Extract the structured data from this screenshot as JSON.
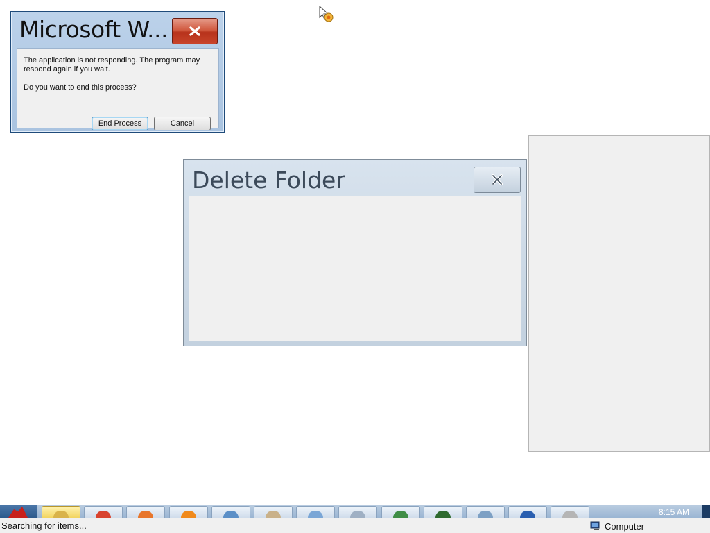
{
  "not_responding_dialog": {
    "title": "Microsoft W...",
    "message": "The application is not responding. The program may respond again if you wait.",
    "question": "Do you want to end this process?",
    "end_process_label": "End Process",
    "cancel_label": "Cancel"
  },
  "delete_folder_dialog": {
    "title": "Delete Folder"
  },
  "taskbar": {
    "clock": "8:15 AM",
    "items": [
      {
        "icon": "folder-icon",
        "color": "#d9b34a"
      },
      {
        "icon": "chrome-icon",
        "color": "#d8432f"
      },
      {
        "icon": "firefox-icon",
        "color": "#e8762b"
      },
      {
        "icon": "vlc-icon",
        "color": "#f08a1c"
      },
      {
        "icon": "picture-viewer-icon",
        "color": "#5b8fc7"
      },
      {
        "icon": "paint-tools-icon",
        "color": "#c9b18a"
      },
      {
        "icon": "paint-icon",
        "color": "#7aa6d6"
      },
      {
        "icon": "document-icon",
        "color": "#9fb0c4"
      },
      {
        "icon": "image-viewer-icon",
        "color": "#3f8d46"
      },
      {
        "icon": "terminal-icon",
        "color": "#2f6a2f"
      },
      {
        "icon": "photo-icon",
        "color": "#7da0c4"
      },
      {
        "icon": "help-icon",
        "color": "#2a5fb0"
      },
      {
        "icon": "recycle-icon",
        "color": "#b5b5b5"
      }
    ]
  },
  "statusbar": {
    "text": "Searching for items...",
    "location": "Computer"
  }
}
